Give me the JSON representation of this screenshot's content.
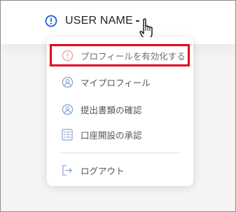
{
  "header": {
    "user_name": "USER NAME",
    "status_icon": "exclamation-circle-icon",
    "status_icon_color": "#1a5fd0"
  },
  "menu": {
    "items": [
      {
        "label": "プロフィールを有効化する",
        "icon": "exclamation-circle-icon",
        "icon_color": "#f0a0a0",
        "highlighted": true
      },
      {
        "label": "マイプロフィール",
        "icon": "user-circle-icon",
        "icon_color": "#8aa9d6"
      },
      {
        "label": "提出書類の確認",
        "icon": "user-circle-icon",
        "icon_color": "#8aa9d6"
      },
      {
        "label": "口座開設の承認",
        "icon": "list-icon",
        "icon_color": "#8aa9d6"
      },
      {
        "label": "ログアウト",
        "icon": "logout-icon",
        "icon_color": "#8aa9d6"
      }
    ],
    "highlight_color": "#e3001b"
  }
}
